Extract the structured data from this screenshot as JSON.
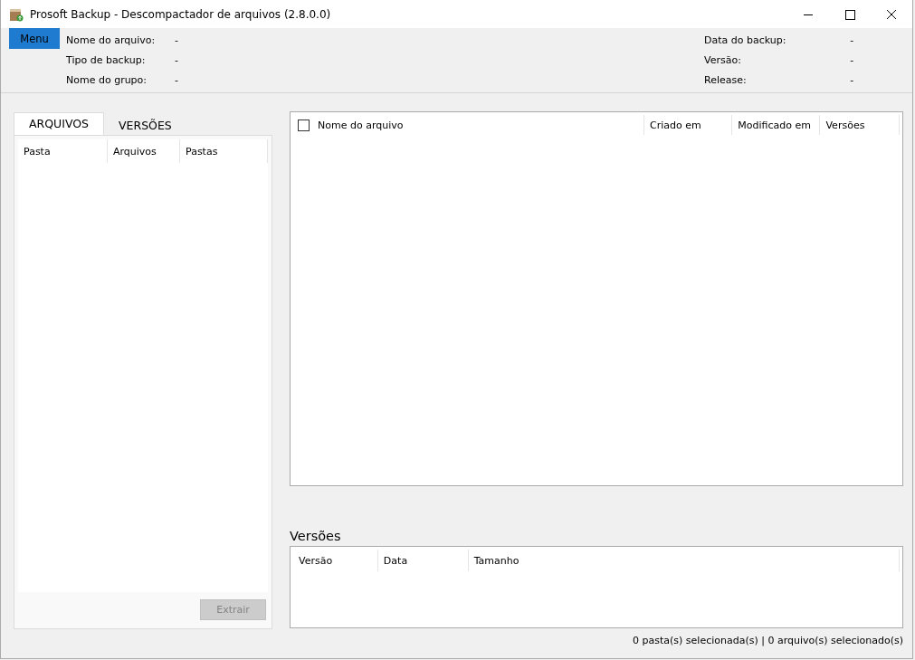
{
  "window": {
    "title": "Prosoft Backup - Descompactador de arquivos (2.8.0.0)"
  },
  "menu_button": "Menu",
  "info_left": [
    {
      "label": "Nome do arquivo:",
      "value": "-"
    },
    {
      "label": "Tipo de backup:",
      "value": "-"
    },
    {
      "label": "Nome do grupo:",
      "value": "-"
    }
  ],
  "info_right": [
    {
      "label": "Data do backup:",
      "value": "-"
    },
    {
      "label": "Versão:",
      "value": "-"
    },
    {
      "label": "Release:",
      "value": "-"
    }
  ],
  "tabs": [
    {
      "label": "ARQUIVOS",
      "selected": true
    },
    {
      "label": "VERSÕES",
      "selected": false
    }
  ],
  "folder_table": {
    "columns": [
      "Pasta",
      "Arquivos",
      "Pastas"
    ]
  },
  "extract_button": {
    "label": "Extrair",
    "disabled": true
  },
  "file_table": {
    "select_all": {
      "checked": false
    },
    "columns": [
      "Nome do arquivo",
      "Criado em",
      "Modificado em",
      "Versões"
    ]
  },
  "versions": {
    "title": "Versões",
    "columns": [
      "Versão",
      "Data",
      "Tamanho"
    ]
  },
  "status_bar": "0 pasta(s) selecionada(s) | 0 arquivo(s) selecionado(s)"
}
